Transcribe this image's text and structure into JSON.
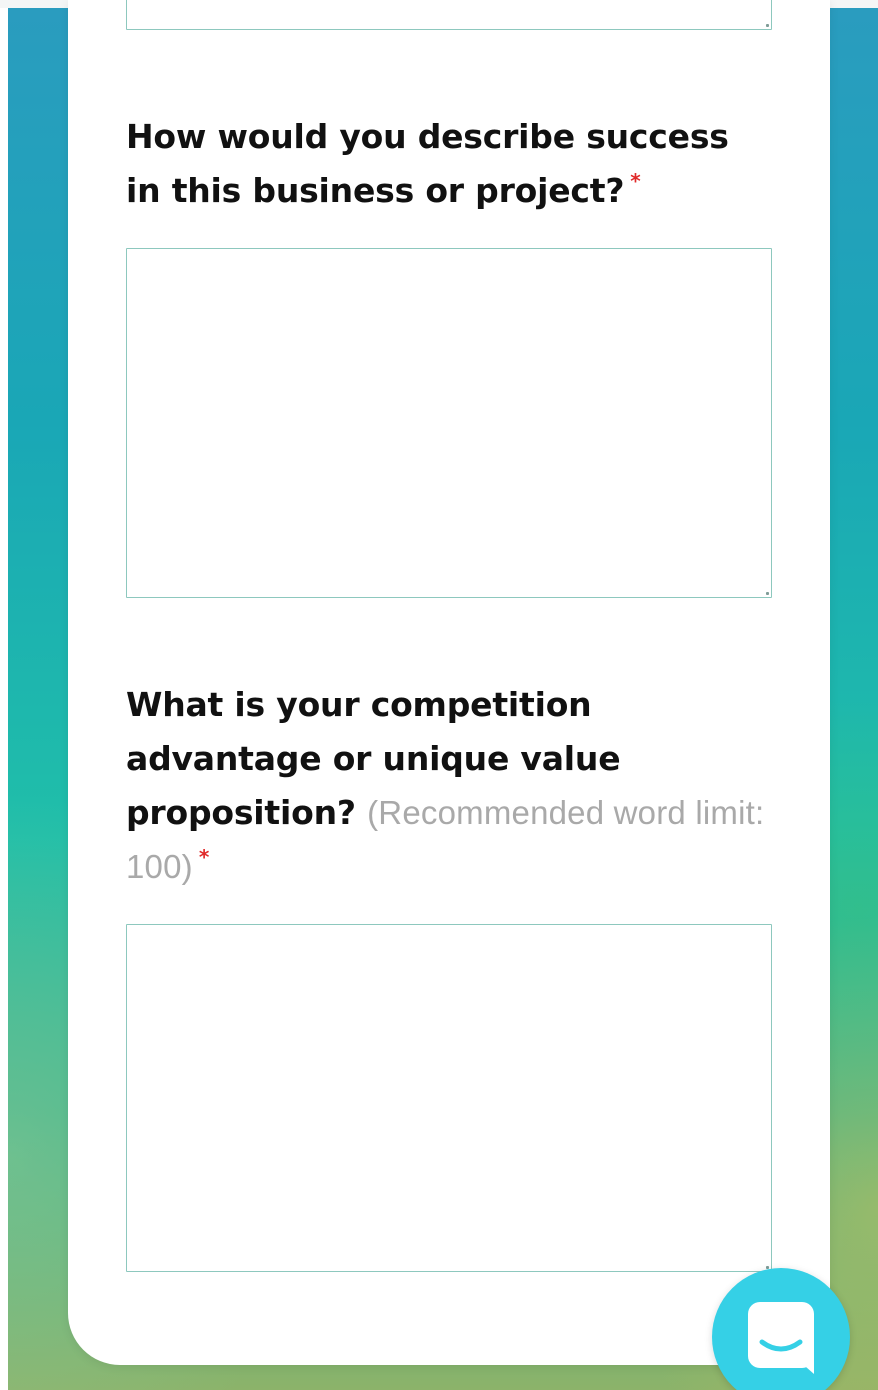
{
  "form": {
    "q1": {
      "text": "How would you describe success in this business or project?",
      "required_mark": "*",
      "value": ""
    },
    "q2": {
      "text": "What is your competition advantage or unique value proposition?",
      "hint": "(Recommended word limit: 100)",
      "required_mark": "*",
      "value": ""
    }
  },
  "chat": {
    "icon": "chat-bubble-icon"
  },
  "colors": {
    "required": "#e02a2a",
    "field_border": "#8dc8be",
    "chat_button": "#35d0e6",
    "hint_text": "#a9a9a9"
  }
}
